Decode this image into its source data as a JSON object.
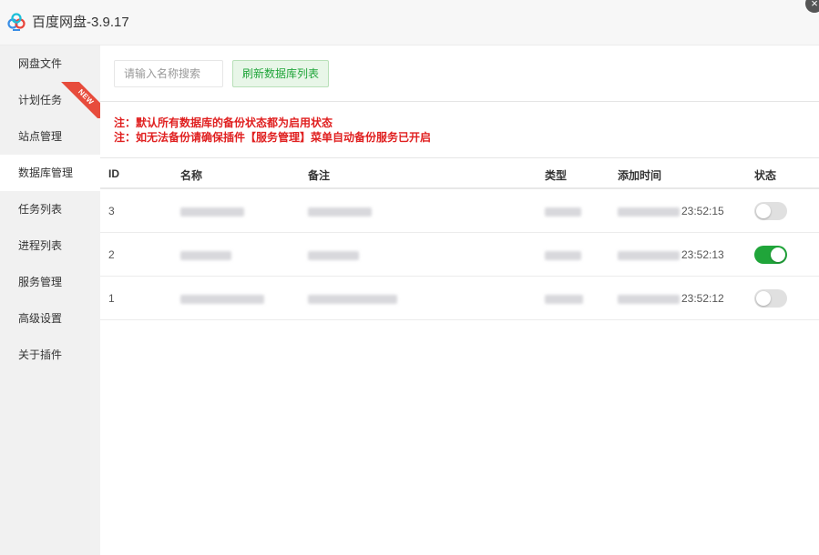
{
  "window": {
    "title": "百度网盘-3.9.17",
    "close_icon": "close-icon",
    "app_icon": "baidu-netdisk-logo"
  },
  "sidebar": {
    "items": [
      {
        "label": "网盘文件"
      },
      {
        "label": "计划任务",
        "badge": "NEW"
      },
      {
        "label": "站点管理"
      },
      {
        "label": "数据库管理",
        "active": true
      },
      {
        "label": "任务列表"
      },
      {
        "label": "进程列表"
      },
      {
        "label": "服务管理"
      },
      {
        "label": "高级设置"
      },
      {
        "label": "关于插件"
      }
    ]
  },
  "toolbar": {
    "search_placeholder": "请输入名称搜索",
    "refresh_label": "刷新数据库列表"
  },
  "notes": {
    "line1": "注：默认所有数据库的备份状态都为启用状态",
    "line2": "注：如无法备份请确保插件【服务管理】菜单自动备份服务已开启"
  },
  "table": {
    "headers": {
      "id": "ID",
      "name": "名称",
      "note": "备注",
      "type": "类型",
      "time": "添加时间",
      "status": "状态"
    },
    "rows": [
      {
        "id": "3",
        "time_suffix": "23:52:15",
        "enabled": false
      },
      {
        "id": "2",
        "time_suffix": "23:52:13",
        "enabled": true
      },
      {
        "id": "1",
        "time_suffix": "23:52:12",
        "enabled": false
      }
    ]
  },
  "colors": {
    "accent_green": "#20a53a",
    "note_red": "#e02020",
    "badge_red": "#e74c3c"
  }
}
